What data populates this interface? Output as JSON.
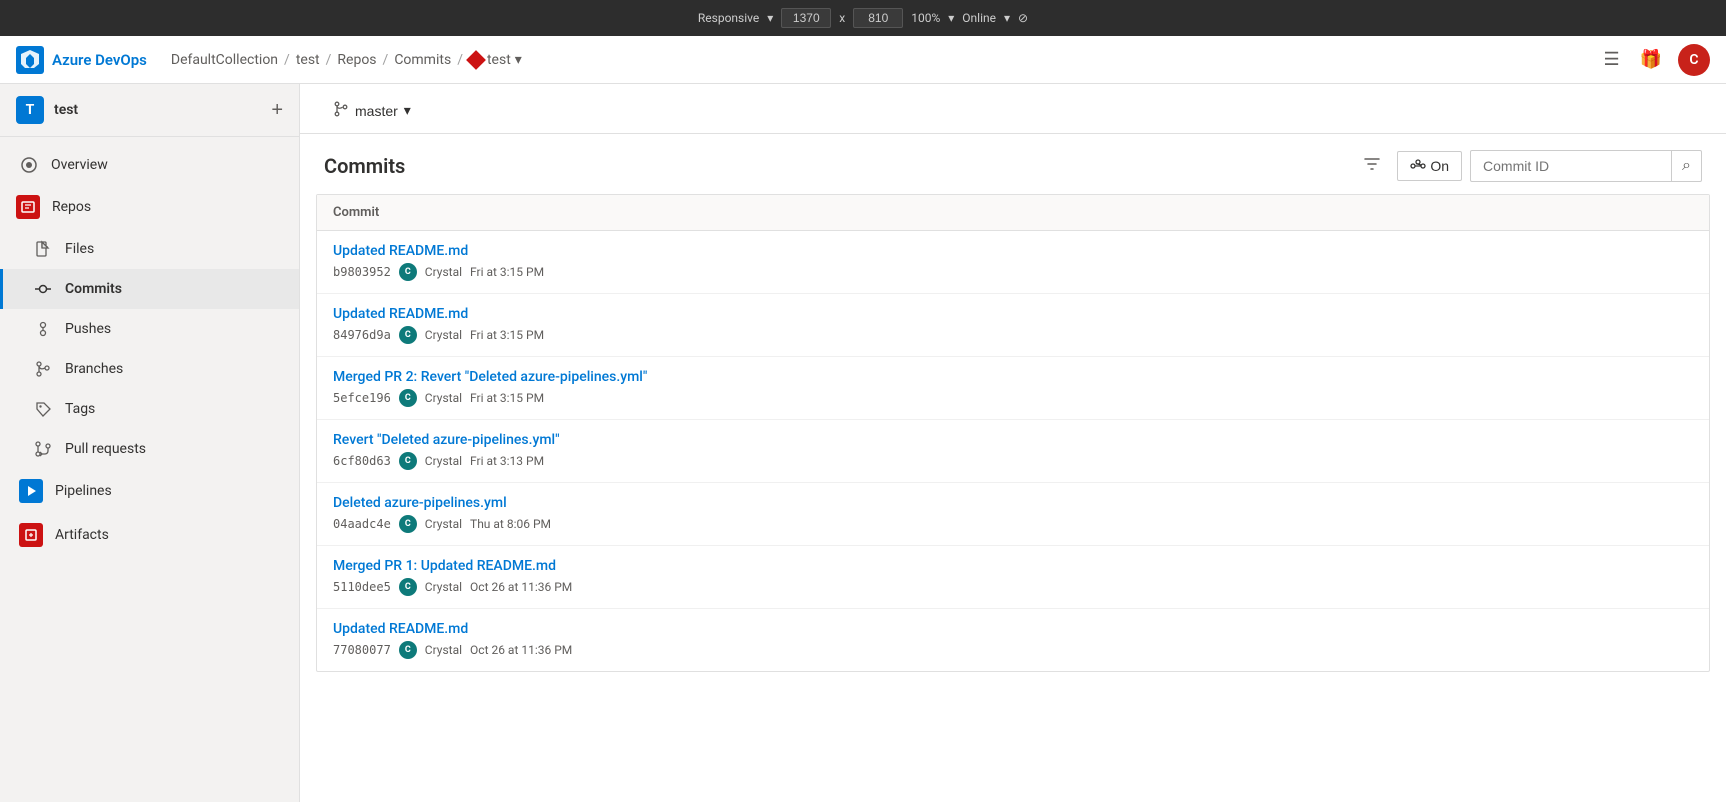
{
  "browser": {
    "responsive_label": "Responsive",
    "width": "1370",
    "x_label": "x",
    "height": "810",
    "zoom_label": "100%",
    "online_label": "Online"
  },
  "top_nav": {
    "logo_text": "Azure DevOps",
    "breadcrumb": {
      "collection": "DefaultCollection",
      "sep1": "/",
      "project": "test",
      "sep2": "/",
      "repos": "Repos",
      "sep3": "/",
      "commits": "Commits",
      "sep4": "/",
      "repo_name": "test"
    },
    "user_initial": "C"
  },
  "sidebar": {
    "project_initial": "T",
    "project_name": "test",
    "add_button_label": "+",
    "items": [
      {
        "id": "overview",
        "label": "Overview",
        "icon": "○"
      },
      {
        "id": "repos",
        "label": "Repos",
        "icon": "◫",
        "highlighted": true
      },
      {
        "id": "files",
        "label": "Files",
        "icon": "▤"
      },
      {
        "id": "commits",
        "label": "Commits",
        "icon": "⌥",
        "active": true
      },
      {
        "id": "pushes",
        "label": "Pushes",
        "icon": "⇡"
      },
      {
        "id": "branches",
        "label": "Branches",
        "icon": "⎇"
      },
      {
        "id": "tags",
        "label": "Tags",
        "icon": "◇"
      },
      {
        "id": "pull-requests",
        "label": "Pull requests",
        "icon": "⤵"
      },
      {
        "id": "pipelines",
        "label": "Pipelines",
        "icon": "▶"
      },
      {
        "id": "artifacts",
        "label": "Artifacts",
        "icon": "⬡"
      }
    ]
  },
  "branch_selector": {
    "branch_name": "master",
    "chevron": "▾"
  },
  "commits_page": {
    "title": "Commits",
    "filter_tooltip": "Filter",
    "graph_on_label": "On",
    "commit_id_placeholder": "Commit ID",
    "table_header": "Commit",
    "commits": [
      {
        "message": "Updated README.md",
        "sha": "b9803952",
        "author": "Crystal",
        "date": "Fri at 3:15 PM",
        "avatar": "C"
      },
      {
        "message": "Updated README.md",
        "sha": "84976d9a",
        "author": "Crystal",
        "date": "Fri at 3:15 PM",
        "avatar": "C"
      },
      {
        "message": "Merged PR 2: Revert \"Deleted azure-pipelines.yml\"",
        "sha": "5efce196",
        "author": "Crystal",
        "date": "Fri at 3:15 PM",
        "avatar": "C"
      },
      {
        "message": "Revert \"Deleted azure-pipelines.yml\"",
        "sha": "6cf80d63",
        "author": "Crystal",
        "date": "Fri at 3:13 PM",
        "avatar": "C"
      },
      {
        "message": "Deleted azure-pipelines.yml",
        "sha": "04aadc4e",
        "author": "Crystal",
        "date": "Thu at 8:06 PM",
        "avatar": "C"
      },
      {
        "message": "Merged PR 1: Updated README.md",
        "sha": "5110dee5",
        "author": "Crystal",
        "date": "Oct 26 at 11:36 PM",
        "avatar": "C"
      },
      {
        "message": "Updated README.md",
        "sha": "77080077",
        "author": "Crystal",
        "date": "Oct 26 at 11:36 PM",
        "avatar": "C"
      }
    ]
  }
}
